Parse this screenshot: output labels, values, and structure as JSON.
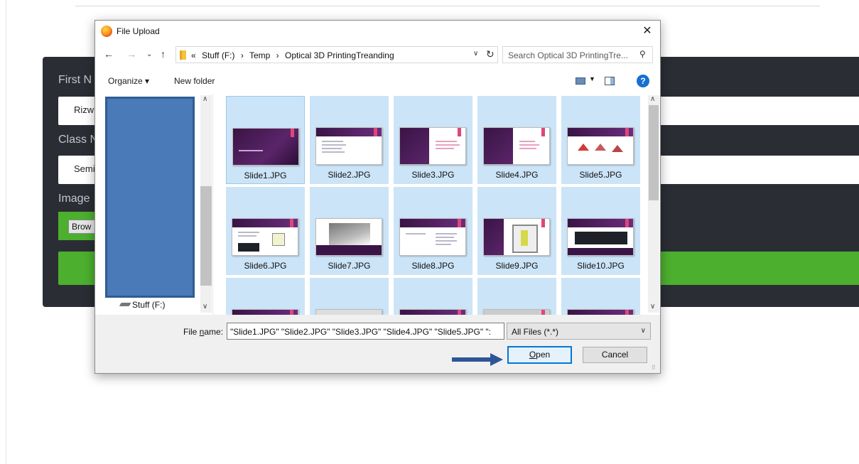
{
  "background_form": {
    "first_name_label": "First N",
    "first_name_value": "Rizw",
    "class_label": "Class N",
    "class_value": "Semi",
    "image_label": "Image",
    "browse_label": "Brow"
  },
  "dialog": {
    "title": "File Upload",
    "close_glyph": "✕",
    "address": {
      "overflow": "«",
      "crumbs": [
        "Stuff (F:)",
        "›",
        "Temp",
        "›",
        "Optical 3D PrintingTreanding"
      ],
      "sep": "›"
    },
    "search_placeholder": "Search Optical 3D PrintingTre...",
    "toolbar": {
      "organize": "Organize ▾",
      "new_folder": "New folder",
      "help": "?"
    },
    "nav_pane": {
      "drive": "Stuff (F:)"
    },
    "files": [
      {
        "name": "Slide1.JPG"
      },
      {
        "name": "Slide2.JPG"
      },
      {
        "name": "Slide3.JPG"
      },
      {
        "name": "Slide4.JPG"
      },
      {
        "name": "Slide5.JPG"
      },
      {
        "name": "Slide6.JPG"
      },
      {
        "name": "Slide7.JPG"
      },
      {
        "name": "Slide8.JPG"
      },
      {
        "name": "Slide9.JPG"
      },
      {
        "name": "Slide10.JPG"
      }
    ],
    "file_name_label_pre": "File ",
    "file_name_label_u": "n",
    "file_name_label_post": "ame:",
    "file_name_value": "\"Slide1.JPG\" \"Slide2.JPG\" \"Slide3.JPG\" \"Slide4.JPG\" \"Slide5.JPG\" \":",
    "file_type": "All Files (*.*)",
    "open_u": "O",
    "open_rest": "pen",
    "cancel": "Cancel"
  },
  "colors": {
    "accent": "#0078d7",
    "selection": "#cce4f7",
    "form_bg": "#2b2d35",
    "form_green": "#4caf2e",
    "arrow": "#2e5597"
  }
}
